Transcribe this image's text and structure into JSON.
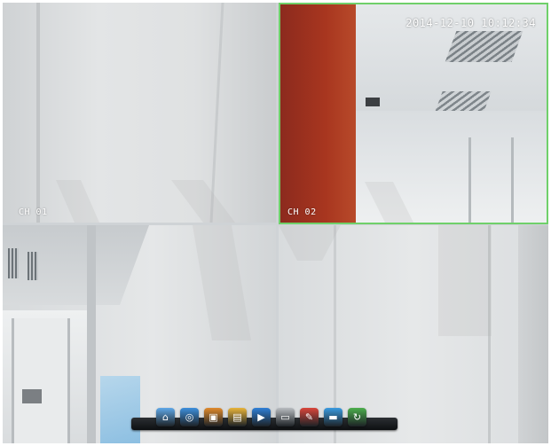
{
  "channels": [
    {
      "id": "ch1",
      "label": "CH 01"
    },
    {
      "id": "ch2",
      "label": "CH 02",
      "selected": true,
      "timestamp": "2014-12-10 10:12:34"
    },
    {
      "id": "ch3",
      "label": ""
    },
    {
      "id": "ch4",
      "label": ""
    }
  ],
  "colors": {
    "selected_border": "#6fd06a",
    "overlay_text": "#ffffff"
  },
  "dock": {
    "items": [
      {
        "name": "home-icon",
        "glyph": "⌂",
        "color": "#5fa8e8"
      },
      {
        "name": "search-icon",
        "glyph": "◎",
        "color": "#3d8fdc"
      },
      {
        "name": "gallery-icon",
        "glyph": "▣",
        "color": "#e08a2c"
      },
      {
        "name": "folder-icon",
        "glyph": "▤",
        "color": "#e8b33a"
      },
      {
        "name": "play-icon",
        "glyph": "▶",
        "color": "#2f7fd6"
      },
      {
        "name": "dvr-icon",
        "glyph": "▭",
        "color": "#b8bcc0"
      },
      {
        "name": "tools-icon",
        "glyph": "✎",
        "color": "#d9453b"
      },
      {
        "name": "display-icon",
        "glyph": "▬",
        "color": "#3a9be0"
      },
      {
        "name": "refresh-icon",
        "glyph": "↻",
        "color": "#4cae4c"
      }
    ]
  }
}
